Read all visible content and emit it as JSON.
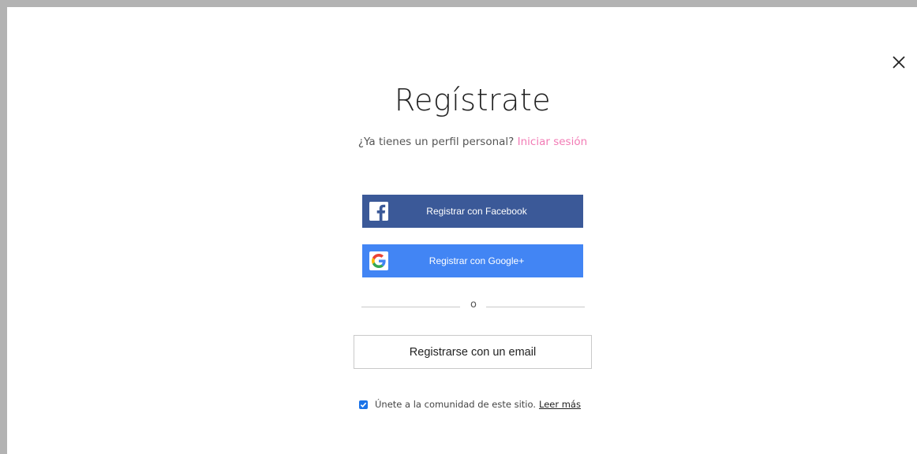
{
  "dialog": {
    "title": "Regístrate",
    "subtitle_text": "¿Ya tienes un perfil personal?",
    "login_link": "Iniciar sesión",
    "facebook_button": "Registrar con Facebook",
    "google_button": "Registrar con Google+",
    "divider_text": "o",
    "email_button": "Registrarse con un email",
    "community_text": "Únete a la comunidad de este sitio.",
    "community_link": "Leer más",
    "community_checked": true
  },
  "colors": {
    "facebook": "#3b5998",
    "google": "#4285f4",
    "link_accent": "#f27bb5",
    "checkbox": "#1a73e8"
  },
  "icons": [
    "close-icon",
    "facebook-icon",
    "google-icon",
    "checkmark-icon"
  ]
}
